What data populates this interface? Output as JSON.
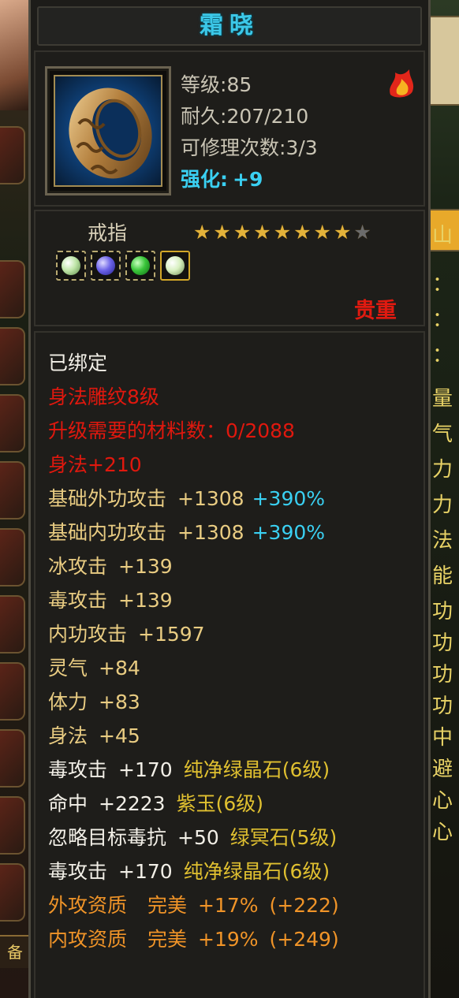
{
  "item": {
    "name": "霜晓",
    "level_label": "等级",
    "level_value": "85",
    "durability_label": "耐久",
    "durability_value": "207/210",
    "repair_label": "可修理次数",
    "repair_value": "3/3",
    "enhance_label": "强化:",
    "enhance_value": "+9",
    "type": "戒指",
    "stars_total": 9,
    "stars_filled": 8,
    "tag": "贵重",
    "icon": "ring-icon"
  },
  "gem_slots": [
    {
      "icon": "white-gem-icon",
      "color": "#bfe5a8"
    },
    {
      "icon": "purple-gem-icon",
      "color": "#6c63e8"
    },
    {
      "icon": "green-gem-icon",
      "color": "#3ac63a"
    },
    {
      "icon": "white-gem-icon",
      "color": "#d7f0c0"
    }
  ],
  "stats": {
    "bound": "已绑定",
    "engrave": "身法雕纹8级",
    "upgrade_materials": "升级需要的材料数：0/2088",
    "agility_bonus": "身法+210",
    "base_outer_attack": {
      "label": "基础外功攻击",
      "value": "+1308",
      "pct": "+390%"
    },
    "base_inner_attack": {
      "label": "基础内功攻击",
      "value": "+1308",
      "pct": "+390%"
    },
    "ice_attack": {
      "label": "冰攻击",
      "value": "+139"
    },
    "poison_attack": {
      "label": "毒攻击",
      "value": "+139"
    },
    "inner_attack": {
      "label": "内功攻击",
      "value": "+1597"
    },
    "spirit": {
      "label": "灵气",
      "value": "+84"
    },
    "stamina": {
      "label": "体力",
      "value": "+83"
    },
    "agility": {
      "label": "身法",
      "value": "+45"
    },
    "gem_line_1": {
      "label": "毒攻击",
      "value": "+170",
      "gem": "纯净绿晶石(6级)"
    },
    "gem_line_2": {
      "label": "命中",
      "value": "+2223",
      "gem": "紫玉(6级)"
    },
    "gem_line_3": {
      "label": "忽略目标毒抗",
      "value": "+50",
      "gem": "绿冥石(5级)"
    },
    "gem_line_4": {
      "label": "毒攻击",
      "value": "+170",
      "gem": "纯净绿晶石(6级)"
    },
    "aptitude_outer": {
      "label": "外攻资质",
      "grade": "完美",
      "value": "+17%",
      "extra": "(+222)"
    },
    "aptitude_inner": {
      "label": "内攻资质",
      "grade": "完美",
      "value": "+19%",
      "extra": "(+249)"
    }
  },
  "background": {
    "left_bottom_char": "备",
    "right_items": [
      "山",
      "：",
      "：",
      "：",
      "量",
      "气",
      "力",
      "力",
      "法",
      "能",
      "功",
      "功",
      "功",
      "功",
      "中",
      "避",
      "心",
      "心"
    ]
  },
  "colors": {
    "title": "#3cc8e8",
    "red": "#e0180e",
    "gold_text": "#e9cc82",
    "orange": "#f09428",
    "cyan": "#3ad0f2"
  }
}
